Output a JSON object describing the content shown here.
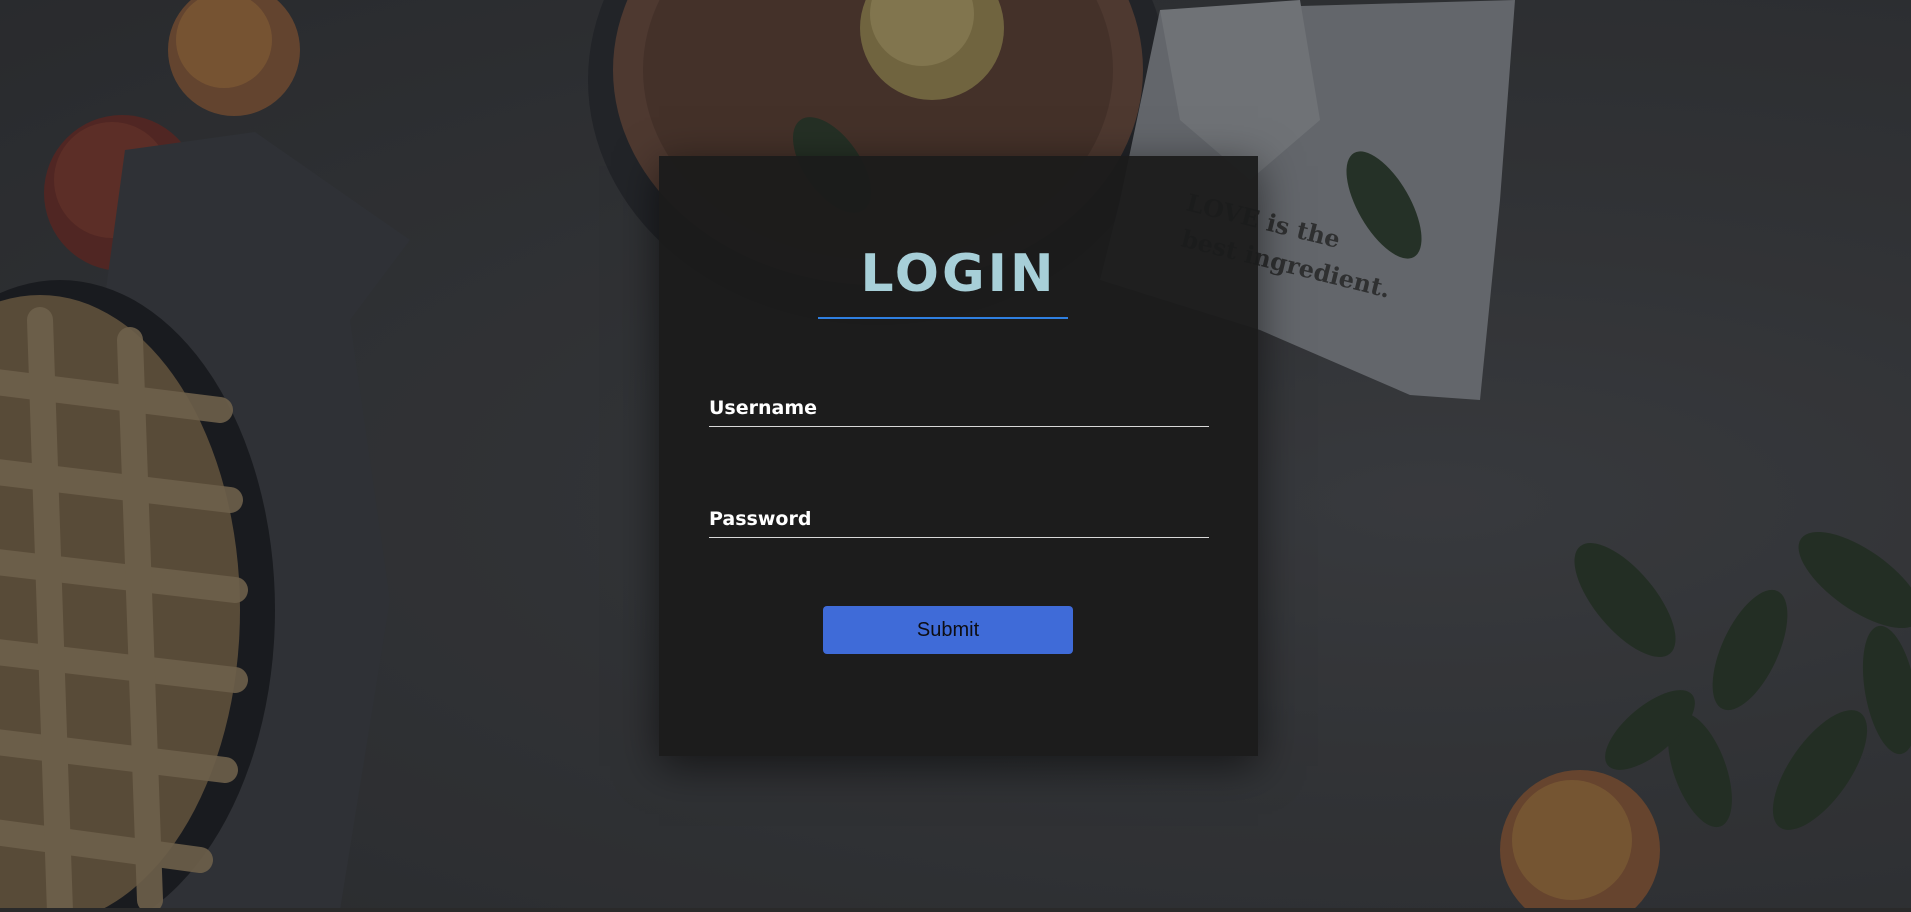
{
  "background": {
    "napkin_print": [
      "LOVE is the",
      "best ingredient."
    ]
  },
  "login": {
    "title": "LOGIN",
    "username_label": "Username",
    "username_value": "",
    "password_label": "Password",
    "password_value": "",
    "submit_label": "Submit"
  },
  "colors": {
    "title": "#a7cfd8",
    "title_underline": "#2f7fe0",
    "submit_button": "#3f6bd8",
    "card": "#1b1b1b"
  }
}
